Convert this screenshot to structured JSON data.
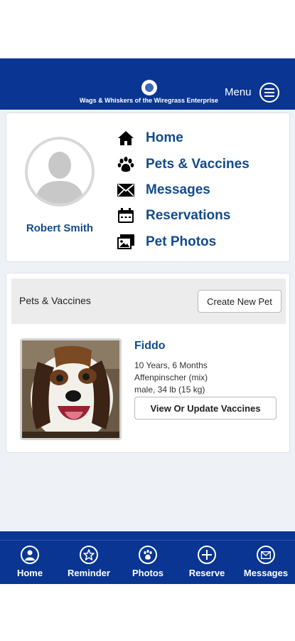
{
  "header": {
    "logo_text": "Wags & Whiskers of the Wiregrass Enterprise",
    "menu_label": "Menu",
    "brand_color": "#0a3592"
  },
  "profile": {
    "name": "Robert Smith"
  },
  "nav": {
    "items": [
      {
        "label": "Home",
        "icon": "home-icon"
      },
      {
        "label": "Pets & Vaccines",
        "icon": "paw-icon"
      },
      {
        "label": "Messages",
        "icon": "envelope-icon"
      },
      {
        "label": "Reservations",
        "icon": "calendar-icon"
      },
      {
        "label": "Pet Photos",
        "icon": "photos-icon"
      }
    ],
    "link_color": "#124b8c"
  },
  "pets": {
    "section_title": "Pets & Vaccines",
    "create_button": "Create New Pet",
    "list": [
      {
        "name": "Fiddo",
        "age": "10 Years, 6 Months",
        "breed": "Affenpinscher (mix)",
        "details": "male, 34 lb (15 kg)",
        "action": "View Or Update Vaccines"
      }
    ]
  },
  "bottom_nav": {
    "tabs": [
      {
        "label": "Home",
        "icon": "home-icon"
      },
      {
        "label": "Reminder",
        "icon": "star-icon"
      },
      {
        "label": "Photos",
        "icon": "paw-icon"
      },
      {
        "label": "Reserve",
        "icon": "plus-icon"
      },
      {
        "label": "Messages",
        "icon": "envelope-icon"
      }
    ]
  }
}
